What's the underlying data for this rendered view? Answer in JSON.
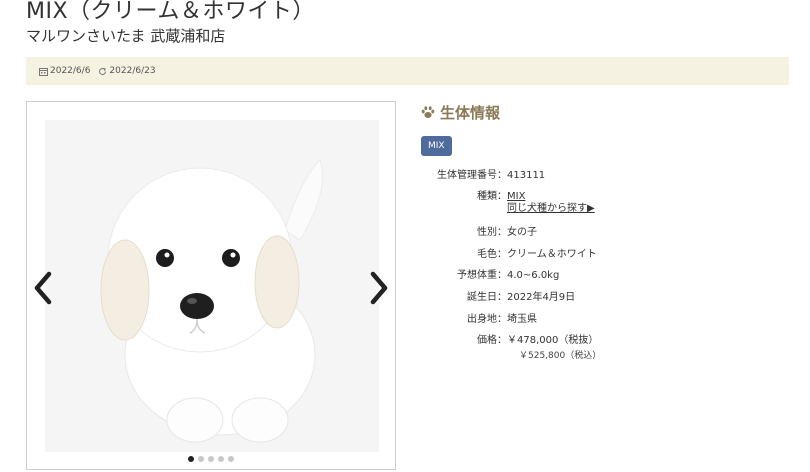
{
  "title": "MIX（クリーム＆ホワイト）",
  "shop_name": "マルワンさいたま 武蔵浦和店",
  "dates": {
    "posted": "2022/6/6",
    "updated": "2022/6/23"
  },
  "slider": {
    "dot_count": 5,
    "active_dot": 0
  },
  "info": {
    "heading": "生体情報",
    "breed_tag": "MIX",
    "rows": [
      {
        "key": "生体管理番号：",
        "value": "413111"
      },
      {
        "key": "種類：",
        "value": "MIX",
        "link2": "同じ犬種から探す▶"
      },
      {
        "key": "性別：",
        "value": "女の子"
      },
      {
        "key": "毛色：",
        "value": "クリーム＆ホワイト"
      },
      {
        "key": "予想体重：",
        "value": "4.0~6.0kg"
      },
      {
        "key": "誕生日：",
        "value": "2022年4月9日"
      },
      {
        "key": "出身地：",
        "value": "埼玉県"
      },
      {
        "key": "価格：",
        "value": "￥478,000（税抜）"
      }
    ],
    "price_tax_included": "￥525,800（税込）"
  },
  "colors": {
    "date_bar_bg": "#f6f2e2",
    "heading": "#8a7a58",
    "tag_bg": "#4f6a9c"
  }
}
